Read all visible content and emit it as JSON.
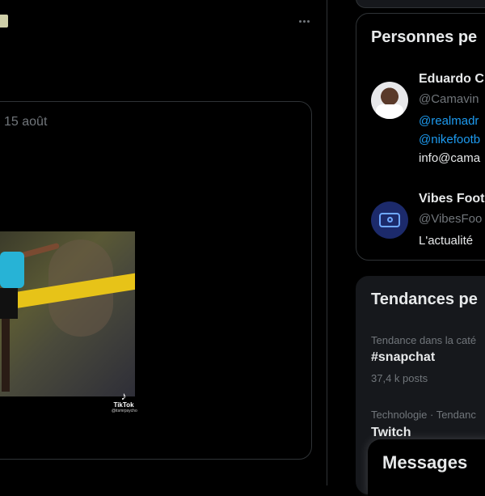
{
  "post": {
    "quote_date": "15 août",
    "media": {
      "tiktok_name": "TikTok",
      "tiktok_handle": "@itsmrpsycho"
    }
  },
  "who_to_follow": {
    "title": "Personnes pe",
    "users": [
      {
        "name": "Eduardo C",
        "handle": "@Camavin",
        "bio_lines": [
          "@realmadr",
          "@nikefootb",
          "info@cama"
        ]
      },
      {
        "name": "Vibes Foot",
        "handle": "@VibesFoo",
        "bio_lines": [
          "L'actualité"
        ]
      }
    ]
  },
  "trends": {
    "title": "Tendances pe",
    "items": [
      {
        "category": "Tendance dans la caté",
        "name": "#snapchat",
        "count": "37,4 k posts"
      },
      {
        "category": "Technologie · Tendanc",
        "name": "Twitch"
      }
    ]
  },
  "messages": {
    "title": "Messages"
  },
  "colors": {
    "background": "#000000",
    "border": "#2f3336",
    "link": "#1d9bf0",
    "muted": "#71767b",
    "text": "#e7e9ea"
  }
}
